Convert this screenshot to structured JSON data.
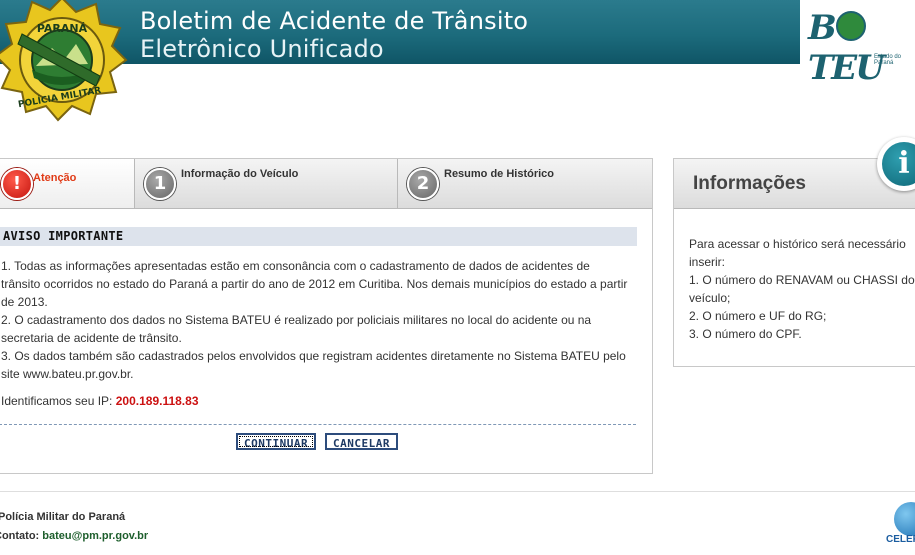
{
  "header": {
    "title_line1": "Boletim de Acidente de Trânsito",
    "title_line2": "Eletrônico Unificado",
    "logo_text": "BATEU",
    "logo_sub": "Estado do Paraná",
    "badge_text_top": "PARANÁ",
    "badge_text_bottom": "POLÍCIA MILITAR"
  },
  "steps": [
    {
      "label": "Atenção",
      "marker": "!"
    },
    {
      "label": "Informação do Veículo",
      "marker": "1"
    },
    {
      "label": "Resumo de Histórico",
      "marker": "2"
    }
  ],
  "notice": {
    "title": "AVISO IMPORTANTE",
    "items": [
      "1. Todas as informações apresentadas estão em consonância com o cadastramento de dados de acidentes de trânsito ocorridos no estado do Paraná a partir do ano de 2012 em Curitiba. Nos demais municípios do estado a partir de 2013.",
      "2. O cadastramento dos dados no Sistema BATEU é realizado por policiais militares no local do acidente ou na secretaria de acidente de trânsito.",
      "3. Os dados também são cadastrados pelos envolvidos que registram acidentes diretamente no Sistema BATEU pelo site www.bateu.pr.gov.br."
    ],
    "ip_label": "Identificamos seu IP:",
    "ip_value": "200.189.118.83"
  },
  "buttons": {
    "continue": "CONTINUAR",
    "cancel": "CANCELAR"
  },
  "info": {
    "title": "Informações",
    "icon": "i",
    "lines": [
      "Para acessar o histórico será necessário inserir:",
      "1. O número do RENAVAM ou CHASSI do veículo;",
      "2. O número e UF do RG;",
      "3. O número do CPF."
    ]
  },
  "footer": {
    "org": "Polícia Militar do Paraná",
    "contact_label": "Contato:",
    "contact_email": "bateu@pm.pr.gov.br",
    "partner": "CELEPAR"
  },
  "colors": {
    "header_bg": "#1c6b7c",
    "accent_red": "#e03a16",
    "ip_red": "#cc1111",
    "button_border": "#2d4c7c"
  }
}
